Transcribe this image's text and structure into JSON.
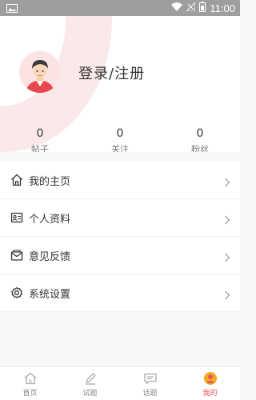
{
  "status_bar": {
    "time": "11:00",
    "battery": "battery-icon",
    "wifi": "wifi-icon",
    "signal": "signal-icon"
  },
  "profile": {
    "login_text": "登录/注册",
    "avatar": "avatar-icon"
  },
  "stats": [
    {
      "value": "0",
      "label": "帖子"
    },
    {
      "value": "0",
      "label": "关注"
    },
    {
      "value": "0",
      "label": "粉丝"
    }
  ],
  "menu": [
    {
      "label": "我的主页",
      "icon": "home-icon"
    },
    {
      "label": "个人资料",
      "icon": "id-card-icon"
    },
    {
      "label": "意见反馈",
      "icon": "mail-icon"
    },
    {
      "label": "系统设置",
      "icon": "gear-icon"
    }
  ],
  "tabs": [
    {
      "label": "首页",
      "icon": "home-icon",
      "active": false
    },
    {
      "label": "试题",
      "icon": "pencil-icon",
      "active": false
    },
    {
      "label": "话题",
      "icon": "chat-icon",
      "active": false
    },
    {
      "label": "我的",
      "icon": "user-icon",
      "active": true
    }
  ],
  "colors": {
    "accent": "#e05258",
    "deco": "#fbe9ea",
    "status_bar": "#9e9e9e"
  }
}
